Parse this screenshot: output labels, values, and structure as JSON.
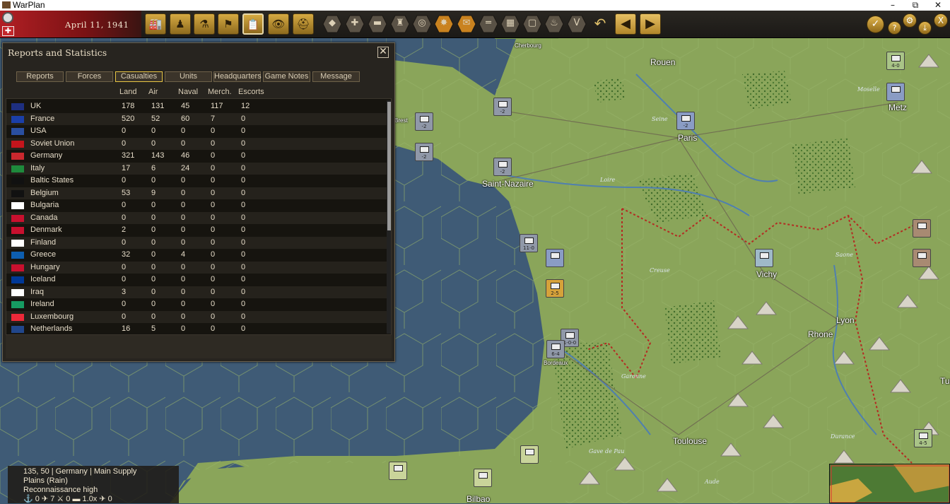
{
  "window": {
    "title": "WarPlan",
    "minimize": "–",
    "maximize": "⧉",
    "close": "✕"
  },
  "header": {
    "date": "April 11, 1941"
  },
  "toolbar": {
    "buttons": [
      {
        "name": "production",
        "glyph": "🏭"
      },
      {
        "name": "diplomacy",
        "glyph": "♟"
      },
      {
        "name": "research",
        "glyph": "⚗"
      },
      {
        "name": "objectives",
        "glyph": "⚑"
      },
      {
        "name": "reports",
        "glyph": "📋"
      },
      {
        "name": "intelligence",
        "glyph": "👁"
      },
      {
        "name": "leaders",
        "glyph": "⛑"
      }
    ],
    "hex_buttons": [
      "◆",
      "✚",
      "▬",
      "♜",
      "◎",
      "✸",
      "✉",
      "═",
      "▦",
      "▢",
      "♨",
      "V"
    ],
    "undo": "↶",
    "prev": "◀",
    "next": "▶",
    "right_buttons": {
      "end_turn": "✓",
      "help": "?",
      "options": "⚙",
      "save": "⤓",
      "exit": "X"
    }
  },
  "panel": {
    "title": "Reports and Statistics",
    "close": "✕",
    "tabs": [
      "Reports",
      "Forces",
      "Casualties",
      "Units",
      "Headquarters",
      "Game Notes",
      "Message"
    ],
    "active_tab": "Casualties",
    "columns": [
      "Land",
      "Air",
      "Naval",
      "Merch.",
      "Escorts"
    ],
    "rows": [
      {
        "country": "UK",
        "land": "178",
        "air": "131",
        "naval": "45",
        "merch": "117",
        "escorts": "12"
      },
      {
        "country": "France",
        "land": "520",
        "air": "52",
        "naval": "60",
        "merch": "7",
        "escorts": "0"
      },
      {
        "country": "USA",
        "land": "0",
        "air": "0",
        "naval": "0",
        "merch": "0",
        "escorts": "0"
      },
      {
        "country": "Soviet Union",
        "land": "0",
        "air": "0",
        "naval": "0",
        "merch": "0",
        "escorts": "0"
      },
      {
        "country": "Germany",
        "land": "321",
        "air": "143",
        "naval": "46",
        "merch": "0",
        "escorts": "0"
      },
      {
        "country": "Italy",
        "land": "17",
        "air": "6",
        "naval": "24",
        "merch": "0",
        "escorts": "0"
      },
      {
        "country": "Baltic States",
        "land": "0",
        "air": "0",
        "naval": "0",
        "merch": "0",
        "escorts": "0"
      },
      {
        "country": "Belgium",
        "land": "53",
        "air": "9",
        "naval": "0",
        "merch": "0",
        "escorts": "0"
      },
      {
        "country": "Bulgaria",
        "land": "0",
        "air": "0",
        "naval": "0",
        "merch": "0",
        "escorts": "0"
      },
      {
        "country": "Canada",
        "land": "0",
        "air": "0",
        "naval": "0",
        "merch": "0",
        "escorts": "0"
      },
      {
        "country": "Denmark",
        "land": "2",
        "air": "0",
        "naval": "0",
        "merch": "0",
        "escorts": "0"
      },
      {
        "country": "Finland",
        "land": "0",
        "air": "0",
        "naval": "0",
        "merch": "0",
        "escorts": "0"
      },
      {
        "country": "Greece",
        "land": "32",
        "air": "0",
        "naval": "4",
        "merch": "0",
        "escorts": "0"
      },
      {
        "country": "Hungary",
        "land": "0",
        "air": "0",
        "naval": "0",
        "merch": "0",
        "escorts": "0"
      },
      {
        "country": "Iceland",
        "land": "0",
        "air": "0",
        "naval": "0",
        "merch": "0",
        "escorts": "0"
      },
      {
        "country": "Iraq",
        "land": "3",
        "air": "0",
        "naval": "0",
        "merch": "0",
        "escorts": "0"
      },
      {
        "country": "Ireland",
        "land": "0",
        "air": "0",
        "naval": "0",
        "merch": "0",
        "escorts": "0"
      },
      {
        "country": "Luxembourg",
        "land": "0",
        "air": "0",
        "naval": "0",
        "merch": "0",
        "escorts": "0"
      },
      {
        "country": "Netherlands",
        "land": "16",
        "air": "5",
        "naval": "0",
        "merch": "0",
        "escorts": "0"
      }
    ]
  },
  "flag_colors": [
    "#1e2f80",
    "#1b3fa8",
    "#2a4fa0",
    "#c4151c",
    "#c9282e",
    "#1e8a3c",
    "#111111",
    "#111111",
    "#ffffff",
    "#c8102e",
    "#c8102e",
    "#ffffff",
    "#0d5eaf",
    "#c8102e",
    "#003897",
    "#ffffff",
    "#169b62",
    "#ed2939",
    "#21468b"
  ],
  "status": {
    "line1": "135, 50 | Germany | Main Supply",
    "line2": "Plains (Rain)",
    "line3": "Reconnaissance high",
    "stats": "⚓ 0   ✈ 7   ⚔ 0   ▬ 1.0x   ✈ 0"
  },
  "map": {
    "cities": [
      "Cherbourg",
      "Rouen",
      "Paris",
      "Metz",
      "Saint-Nazaire",
      "Vichy",
      "Lyon",
      "Bordeaux",
      "Toulouse",
      "Bilbao",
      "Rhone",
      "Brest",
      "Turin"
    ],
    "rivers": [
      "Seine",
      "Moselle",
      "Loire",
      "Creuse",
      "Saone",
      "Garonne",
      "Durance",
      "Gave de Pau",
      "Aude"
    ],
    "unit_values": [
      "-2",
      "-2",
      "-2",
      "-2",
      "4-0",
      "-2",
      "11-0",
      "2-5",
      "1-0-0",
      "6-4",
      "4-5"
    ]
  }
}
